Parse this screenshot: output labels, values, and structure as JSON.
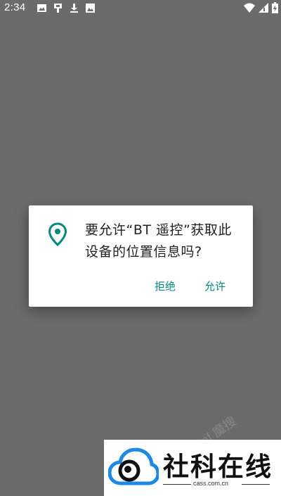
{
  "status_bar": {
    "time": "2:34",
    "left_icons": [
      "image-icon",
      "usb-icon",
      "download-icon",
      "photo-icon"
    ],
    "right_icons": [
      "wifi-icon",
      "signal-icon",
      "battery-icon"
    ]
  },
  "dialog": {
    "icon": "location-pin-icon",
    "message": "要允许“BT 遥控”获取此设备的位置信息吗?",
    "deny_label": "拒绝",
    "allow_label": "允许",
    "accent_color": "#00897b"
  },
  "watermark": {
    "title": "社科在线",
    "domain": "cass.com.cn",
    "faint_text": "mf 魔搜"
  }
}
